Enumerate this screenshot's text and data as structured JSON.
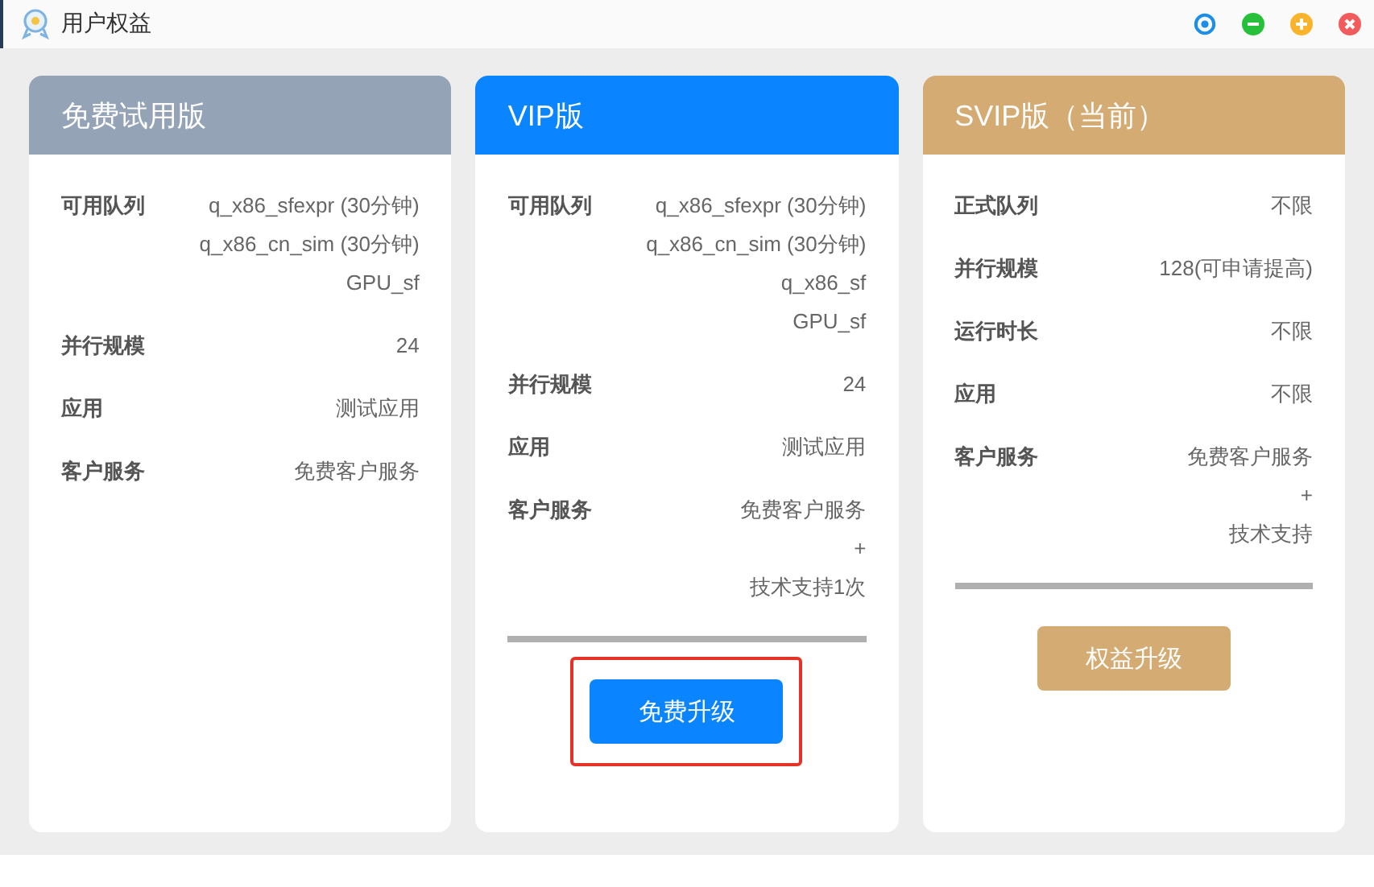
{
  "window": {
    "title": "用户权益"
  },
  "cards": [
    {
      "title": "免费试用版",
      "color": "#95a3b6",
      "rows": [
        {
          "label": "可用队列",
          "values": [
            "q_x86_sfexpr (30分钟)",
            "q_x86_cn_sim (30分钟)",
            "GPU_sf"
          ]
        },
        {
          "label": "并行规模",
          "values": [
            "24"
          ]
        },
        {
          "label": "应用",
          "values": [
            "测试应用"
          ]
        },
        {
          "label": "客户服务",
          "values": [
            "免费客户服务"
          ]
        }
      ]
    },
    {
      "title": "VIP版",
      "color": "#0a84ff",
      "rows": [
        {
          "label": "可用队列",
          "values": [
            "q_x86_sfexpr (30分钟)",
            "q_x86_cn_sim (30分钟)",
            "q_x86_sf",
            "GPU_sf"
          ]
        },
        {
          "label": "并行规模",
          "values": [
            "24"
          ]
        },
        {
          "label": "应用",
          "values": [
            "测试应用"
          ]
        },
        {
          "label": "客户服务",
          "values": [
            "免费客户服务",
            "+",
            "技术支持1次"
          ]
        }
      ],
      "button": {
        "label": "免费升级",
        "highlighted": true
      }
    },
    {
      "title": "SVIP版（当前）",
      "color": "#d4ab72",
      "rows": [
        {
          "label": "正式队列",
          "values": [
            "不限"
          ]
        },
        {
          "label": "并行规模",
          "values": [
            "128(可申请提高)"
          ]
        },
        {
          "label": "运行时长",
          "values": [
            "不限"
          ]
        },
        {
          "label": "应用",
          "values": [
            "不限"
          ]
        },
        {
          "label": "客户服务",
          "values": [
            "免费客户服务",
            "+",
            "技术支持"
          ]
        }
      ],
      "button": {
        "label": "权益升级",
        "highlighted": false
      }
    }
  ]
}
